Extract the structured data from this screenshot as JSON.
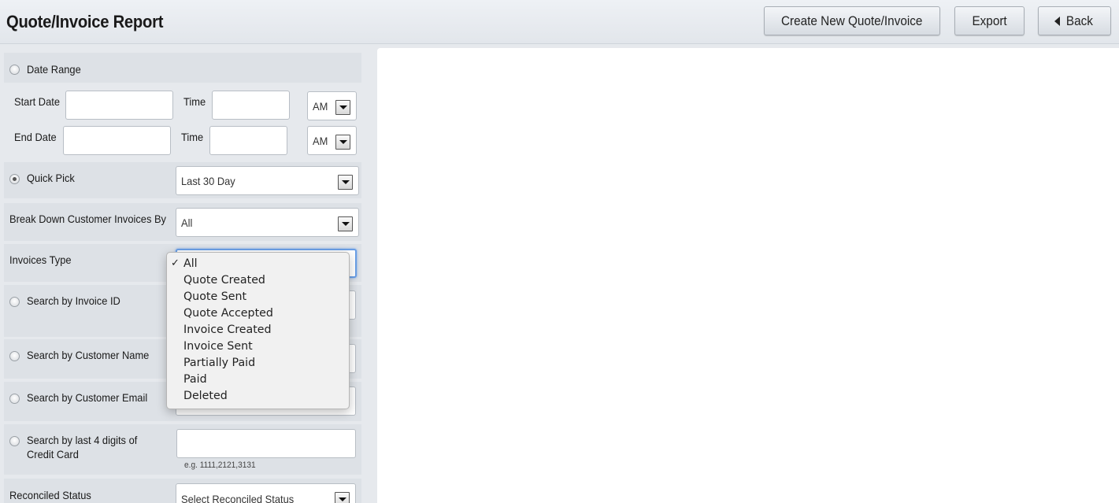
{
  "header": {
    "title": "Quote/Invoice Report",
    "create_label": "Create New Quote/Invoice",
    "export_label": "Export",
    "back_label": "Back"
  },
  "filters": {
    "date_range_label": "Date Range",
    "start_date_label": "Start Date",
    "end_date_label": "End Date",
    "time_label": "Time",
    "start_ampm": "AM",
    "end_ampm": "AM",
    "quick_pick_label": "Quick Pick",
    "quick_pick_value": "Last 30 Day",
    "breakdown_label": "Break Down Customer Invoices By",
    "breakdown_value": "All",
    "invoices_type_label": "Invoices Type",
    "invoice_id_label": "Search by Invoice ID",
    "customer_name_label": "Search by Customer Name",
    "customer_email_label": "Search by Customer Email",
    "credit_card_label_1": "Search by last 4 digits of",
    "credit_card_label_2": "Credit Card",
    "credit_card_hint": "e.g. 1111,2121,3131",
    "reconciled_label": "Reconciled Status",
    "reconciled_placeholder": "Select Reconciled Status"
  },
  "invoice_type_dropdown": {
    "selected": "All",
    "check_glyph": "✓",
    "options": [
      "All",
      "Quote Created",
      "Quote Sent",
      "Quote Accepted",
      "Invoice Created",
      "Invoice Sent",
      "Partially Paid",
      "Paid",
      "Deleted"
    ]
  }
}
